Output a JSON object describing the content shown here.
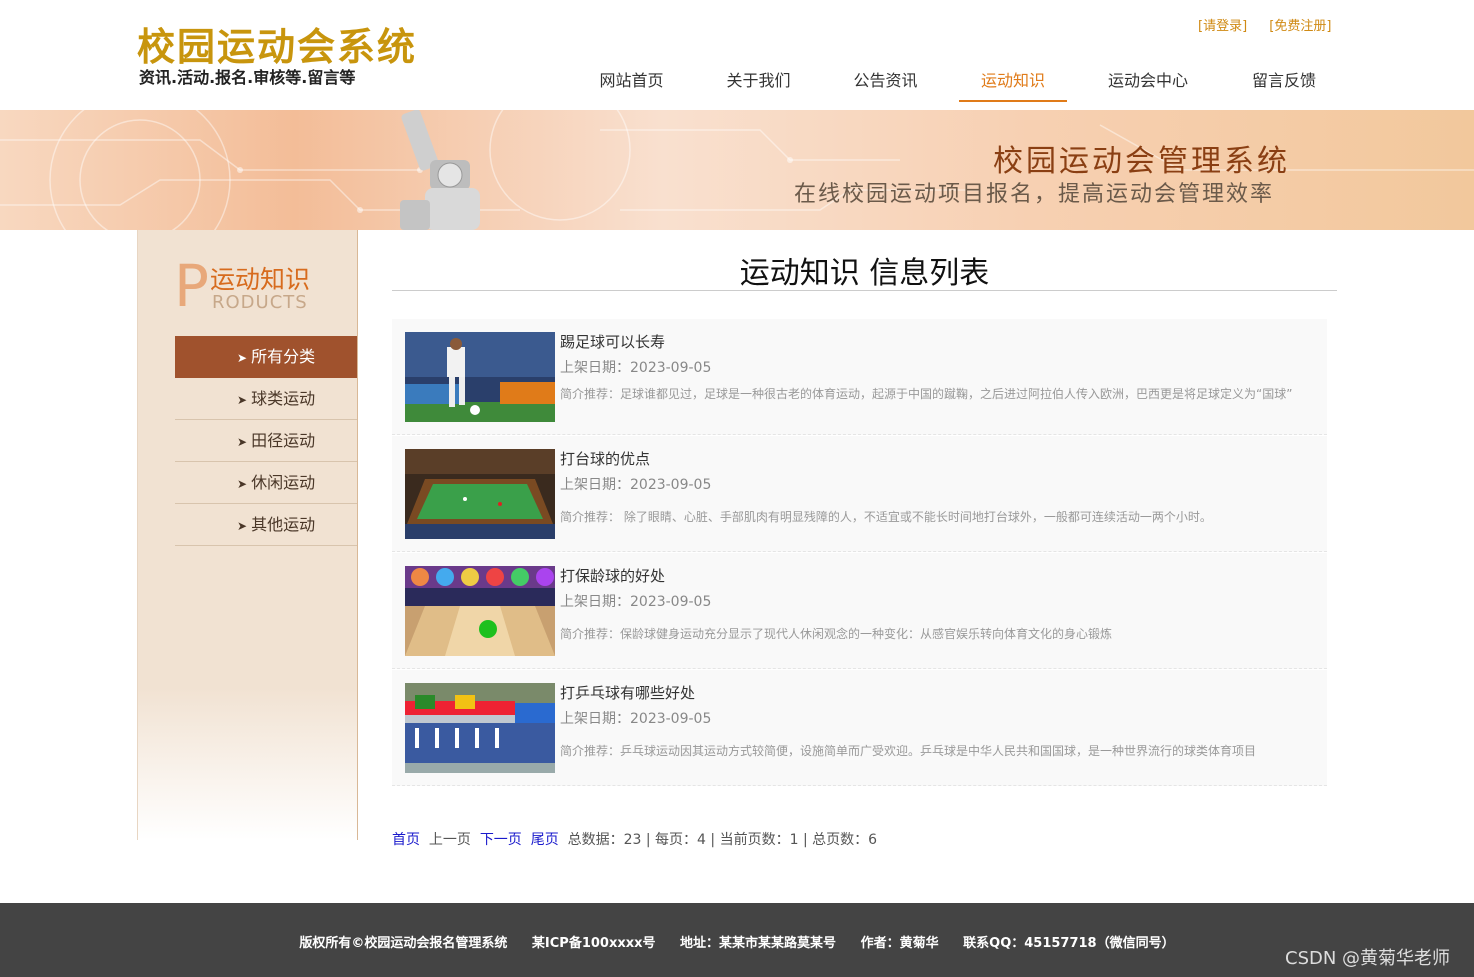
{
  "header": {
    "title": "校园运动会系统",
    "subtitle": "资讯.活动.报名.审核等.留言等",
    "login": "[请登录]",
    "register": "[免费注册]"
  },
  "nav": {
    "items": [
      {
        "label": "网站首页"
      },
      {
        "label": "关于我们"
      },
      {
        "label": "公告资讯"
      },
      {
        "label": "运动知识"
      },
      {
        "label": "运动会中心"
      },
      {
        "label": "留言反馈"
      }
    ],
    "active": "运动知识"
  },
  "banner": {
    "title": "校园运动会管理系统",
    "subtitle": "在线校园运动项目报名，提高运动会管理效率"
  },
  "sidebar": {
    "big_letter": "P",
    "title": "运动知识",
    "title_en": "RODUCTS",
    "categories": [
      {
        "label": "所有分类"
      },
      {
        "label": "球类运动"
      },
      {
        "label": "田径运动"
      },
      {
        "label": "休闲运动"
      },
      {
        "label": "其他运动"
      }
    ]
  },
  "main": {
    "title": "运动知识 信息列表",
    "items": [
      {
        "title": "踢足球可以长寿",
        "date": "上架日期：2023-09-05",
        "desc": "简介推荐：足球谁都见过，足球是一种很古老的体育运动，起源于中国的蹴鞠，之后进过阿拉伯人传入欧洲，巴西更是将足球定义为“国球”"
      },
      {
        "title": "打台球的优点",
        "date": "上架日期：2023-09-05",
        "desc": "简介推荐： 除了眼睛、心脏、手部肌肉有明显残障的人，不适宜或不能长时间地打台球外，一般都可连续活动一两个小时。"
      },
      {
        "title": "打保龄球的好处",
        "date": "上架日期：2023-09-05",
        "desc": "简介推荐：保龄球健身运动充分显示了现代人休闲观念的一种变化：从感官娱乐转向体育文化的身心锻炼"
      },
      {
        "title": "打乒乓球有哪些好处",
        "date": "上架日期：2023-09-05",
        "desc": "简介推荐：乒乓球运动因其运动方式较简便，设施简单而广受欢迎。乒乓球是中华人民共和国国球，是一种世界流行的球类体育项目"
      }
    ]
  },
  "pager": {
    "first": "首页",
    "prev": "上一页",
    "next": "下一页",
    "last": "尾页",
    "info": "总数据：23 | 每页：4 | 当前页数：1 | 总页数：6"
  },
  "footer": {
    "copyright": "版权所有©校园运动会报名管理系统",
    "icp": "某ICP备100xxxx号",
    "address": "地址：某某市某某路莫某号",
    "author": "作者：黄菊华",
    "qq": "联系QQ：45157718（微信同号）"
  },
  "watermark": "CSDN @黄菊华老师",
  "colors": {
    "accent": "#e07b19",
    "logo": "#c8950d",
    "sidebar_active": "#a0522d",
    "footer_bg": "#444444"
  }
}
